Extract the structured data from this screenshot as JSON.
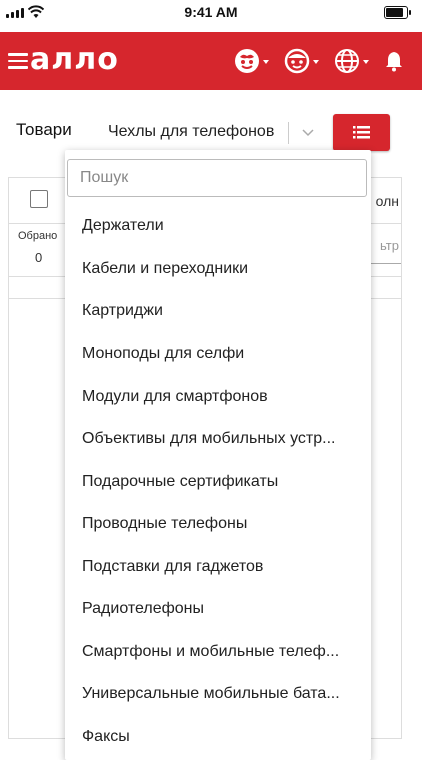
{
  "status_bar": {
    "time": "9:41 AM"
  },
  "header": {
    "logo": "аллo",
    "colors": {
      "brand": "#d6262d",
      "icon": "#ffffff"
    },
    "icons": [
      "menu-icon",
      "face-icon",
      "smiley-icon",
      "globe-icon",
      "bell-icon"
    ]
  },
  "toolbar": {
    "label": "Товари",
    "selected_category": "Чехлы для телефонов"
  },
  "table": {
    "selected_label": "Обрано",
    "selected_count": "0",
    "column_head_fragment": "олн",
    "filter_fragment": "ьтр"
  },
  "dropdown": {
    "search_placeholder": "Пошук",
    "items": [
      "Держатели",
      "Кабели и переходники",
      "Картриджи",
      "Моноподы для селфи",
      "Модули для смартфонов",
      "Объективы для мобильных устр...",
      "Подарочные сертификаты",
      "Проводные телефоны",
      "Подставки для гаджетов",
      "Радиотелефоны",
      "Смартфоны и мобильные телеф...",
      "Универсальные мобильные бата...",
      "Факсы"
    ]
  }
}
